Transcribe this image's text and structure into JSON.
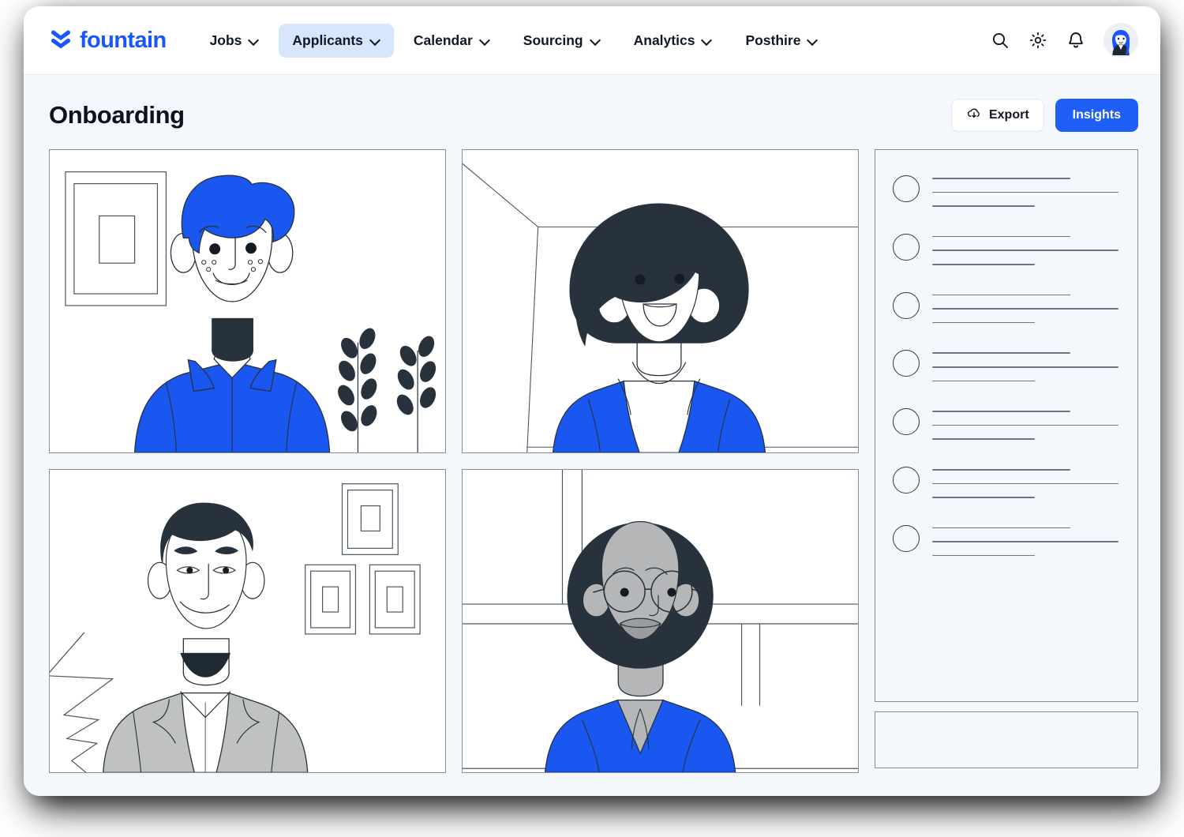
{
  "brand": {
    "name": "fountain",
    "logo_icon": "fountain-logo-icon",
    "color": "#1A56FF"
  },
  "topnav": {
    "items": [
      {
        "label": "Jobs",
        "active": false,
        "icon": "chevron-down-icon"
      },
      {
        "label": "Applicants",
        "active": true,
        "icon": "chevron-down-icon"
      },
      {
        "label": "Calendar",
        "active": false,
        "icon": "chevron-down-icon"
      },
      {
        "label": "Sourcing",
        "active": false,
        "icon": "chevron-down-icon"
      },
      {
        "label": "Analytics",
        "active": false,
        "icon": "chevron-down-icon"
      },
      {
        "label": "Posthire",
        "active": false,
        "icon": "chevron-down-icon"
      }
    ],
    "tools": [
      {
        "icon": "search-icon"
      },
      {
        "icon": "gear-icon"
      },
      {
        "icon": "bell-icon"
      },
      {
        "icon": "avatar"
      }
    ],
    "active_tab_bg": "#d8e6fd"
  },
  "page": {
    "title": "Onboarding",
    "export_label": "Export",
    "export_icon": "cloud-download-icon",
    "insights_label": "Insights",
    "insights_color": "#1f5ff5"
  },
  "tiles": [
    {
      "id": "participant-1",
      "name": "man-blue-hair-blue-shirt",
      "description": "Illustrated man with blue hair and blue collared shirt, picture frame on wall, plant at right",
      "accent": "#1a56f0",
      "hair": "#1a56f0",
      "shirt": "#1a56f0"
    },
    {
      "id": "participant-2",
      "name": "woman-dark-bob-blue-blazer",
      "description": "Illustrated woman with dark bob haircut, blue blazer over white top, room corner in background",
      "accent": "#1a56f0",
      "hair": "#28323c",
      "shirt": "#1a56f0"
    },
    {
      "id": "participant-3",
      "name": "man-dark-hair-gray-suit",
      "description": "Illustrated man with dark hair in a gray suit and white shirt, three picture frames on wall, plant at left",
      "accent": "#bfbfbf",
      "hair": "#28323c",
      "shirt": "#bfbfbf"
    },
    {
      "id": "participant-4",
      "name": "woman-afro-glasses-blue-top",
      "description": "Illustrated woman with afro and round glasses wearing a blue v-neck top, bookshelf in background",
      "accent": "#1a56f0",
      "hair": "#28323c",
      "shirt": "#1a56f0"
    }
  ],
  "sidebar": {
    "checklist": {
      "name": "placeholder-checklist",
      "rows": [
        {
          "circle": "empty-radio-icon",
          "lines": [
            "med",
            "long",
            "short"
          ]
        },
        {
          "circle": "empty-radio-icon",
          "lines": [
            "med",
            "long",
            "short"
          ]
        },
        {
          "circle": "empty-radio-icon",
          "lines": [
            "med",
            "long",
            "short"
          ]
        },
        {
          "circle": "empty-radio-icon",
          "lines": [
            "med",
            "long",
            "short"
          ]
        },
        {
          "circle": "empty-radio-icon",
          "lines": [
            "med",
            "long",
            "short"
          ]
        },
        {
          "circle": "empty-radio-icon",
          "lines": [
            "med",
            "long",
            "short"
          ]
        },
        {
          "circle": "empty-radio-icon",
          "lines": [
            "med",
            "long",
            "short"
          ]
        }
      ]
    },
    "footer_panel": {
      "name": "empty-placeholder-panel"
    }
  },
  "theme": {
    "window_bg": "#f4f7fb",
    "panel_border": "#868e99",
    "line_color": "#6b7684",
    "text_dark": "#0b1220"
  }
}
